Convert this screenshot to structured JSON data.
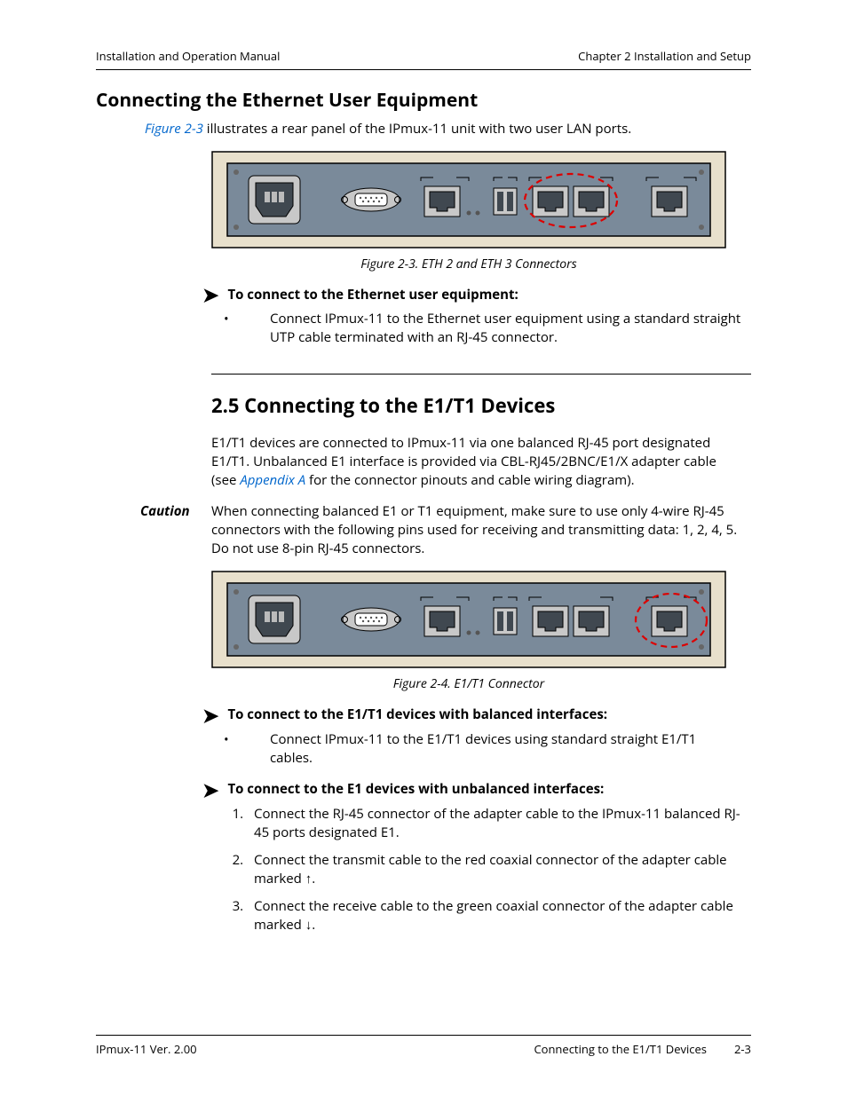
{
  "header": {
    "left": "Installation and Operation Manual",
    "right": "Chapter 2  Installation and Setup"
  },
  "h2": "Connecting the Ethernet User Equipment",
  "intro": {
    "link": "Figure 2-3",
    "rest": " illustrates a rear panel of the IPmux-11 unit with two user LAN ports."
  },
  "figcap1": "Figure 2-3.  ETH 2 and ETH 3 Connectors",
  "proc1head": "To connect to the Ethernet user equipment:",
  "proc1item1": "Connect IPmux-11 to the Ethernet user equipment using a standard straight UTP cable terminated with an RJ-45 connector.",
  "sect25": "2.5  Connecting to the E1/T1 Devices",
  "para25a": "E1/T1 devices are connected to IPmux-11 via one balanced RJ-45 port designated E1/T1. Unbalanced E1 interface is provided via CBL-RJ45/2BNC/E1/X adapter cable (see ",
  "para25a_link": "Appendix A",
  "para25a_tail": " for the connector pinouts and cable wiring diagram).",
  "caution_label": "Caution",
  "caution_text": "When connecting balanced E1 or T1 equipment, make sure to use only 4-wire RJ-45 connectors with the following pins used for receiving and transmitting data: 1, 2, 4, 5. Do not use 8-pin RJ-45 connectors.",
  "figcap2": "Figure 2-4.  E1/T1 Connector",
  "proc2head": "To connect to the E1/T1 devices with balanced interfaces:",
  "proc2item1": "Connect IPmux-11 to the E1/T1 devices using standard straight E1/T1 cables.",
  "proc3head": "To connect to the E1 devices with unbalanced interfaces:",
  "proc3n1": "Connect the RJ-45 connector of the adapter cable to the IPmux-11 balanced RJ-45 ports designated E1.",
  "proc3n2a": "Connect the transmit cable to the red coaxial connector of the adapter cable marked ",
  "proc3n2b": ".",
  "proc3n3a": "Connect the receive cable to the green coaxial connector of the adapter cable marked ",
  "proc3n3b": ".",
  "footer": {
    "left": "IPmux-11 Ver. 2.00",
    "center": "Connecting to the E1/T1 Devices",
    "right": "2-3"
  }
}
